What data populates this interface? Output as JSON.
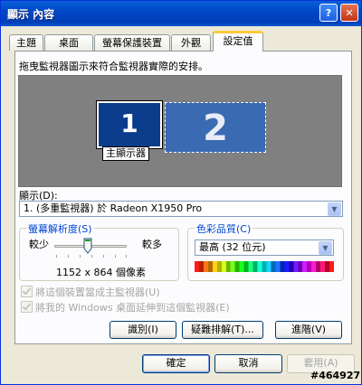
{
  "window": {
    "title": "顯示 內容",
    "help_glyph": "?",
    "close_glyph": "✕"
  },
  "tabs": [
    {
      "label": "主題",
      "active": false
    },
    {
      "label": "桌面",
      "active": false
    },
    {
      "label": "螢幕保護裝置",
      "active": false
    },
    {
      "label": "外觀",
      "active": false
    },
    {
      "label": "設定值",
      "active": true
    }
  ],
  "instructions": "拖曳監視器圖示來符合監視器實際的安排。",
  "monitors": [
    {
      "number": "1",
      "label": "主顯示器",
      "selected": true
    },
    {
      "number": "2",
      "selected": false
    }
  ],
  "display": {
    "label": "顯示(D):",
    "value": "1. (多重監視器) 於 Radeon X1950 Pro"
  },
  "resolution": {
    "group_label": "螢幕解析度(S)",
    "less": "較少",
    "more": "較多",
    "value": "1152 x 864 個像素"
  },
  "color_quality": {
    "group_label": "色彩品質(C)",
    "value": "最高 (32 位元)"
  },
  "checkboxes": [
    {
      "label": "將這個裝置當成主監視器(U)",
      "checked": true
    },
    {
      "label": "將我的 Windows 桌面延伸到這個監視器(E)",
      "checked": true
    }
  ],
  "panel_buttons": {
    "identify": "識別(I)",
    "troubleshoot": "疑難排解(T)...",
    "advanced": "進階(V)"
  },
  "dialog_buttons": {
    "ok": "確定",
    "cancel": "取消",
    "apply": "套用(A)"
  },
  "watermark": "#464927",
  "colors": {
    "title_bar": "#0048c8",
    "selected_monitor": "#0c3c8c",
    "group_label": "#0046d5",
    "preview_bg": "#808080"
  }
}
